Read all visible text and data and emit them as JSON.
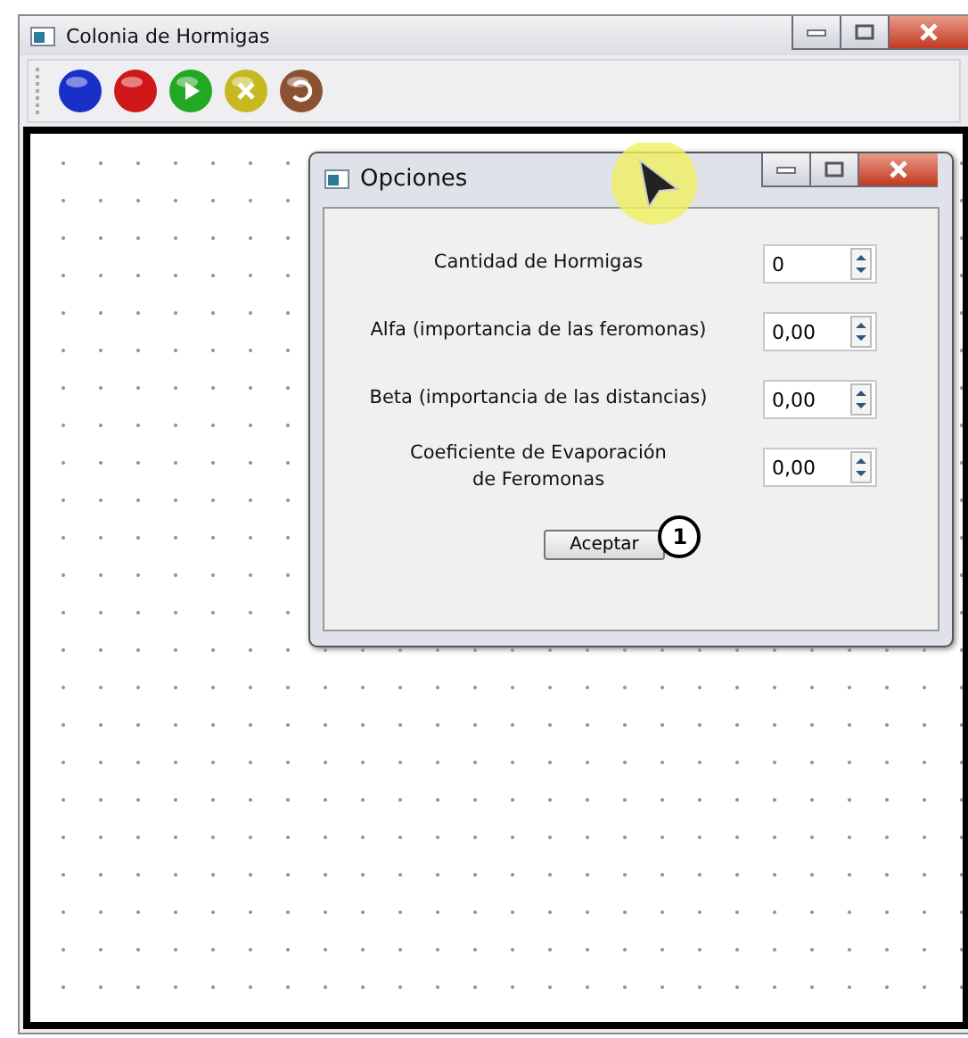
{
  "window": {
    "title": "Colonia de Hormigas"
  },
  "toolbar": [
    {
      "kind": "plain",
      "color": "#1a2fc8"
    },
    {
      "kind": "plain",
      "color": "#d01818"
    },
    {
      "kind": "play",
      "color": "#22a822"
    },
    {
      "kind": "cross",
      "color": "#c8b820"
    },
    {
      "kind": "undo",
      "color": "#8a5230"
    }
  ],
  "dialog": {
    "title": "Opciones",
    "fields": [
      {
        "label": "Cantidad de Hormigas",
        "value": "0"
      },
      {
        "label": "Alfa (importancia de las feromonas)",
        "value": "0,00"
      },
      {
        "label": "Beta (importancia de las distancias)",
        "value": "0,00"
      },
      {
        "label": "Coeficiente de Evaporación\nde Feromonas",
        "value": "0,00"
      }
    ],
    "button": "Aceptar",
    "callout": "1"
  }
}
